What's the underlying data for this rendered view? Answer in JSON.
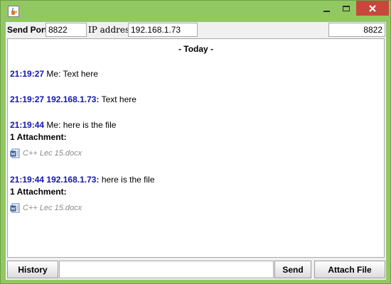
{
  "toolbar": {
    "send_port_label": "Send Port",
    "send_port_value": "8822",
    "ip_label": "IP address",
    "ip_value": "192.168.1.73",
    "listen_port_value": "8822"
  },
  "chat": {
    "day_header": "- Today -",
    "messages": [
      {
        "time": "21:19:27",
        "sender": "Me",
        "text": "Text here"
      },
      {
        "time": "21:19:27",
        "sender": "192.168.1.73",
        "text": "Text here"
      },
      {
        "time": "21:19:44",
        "sender": "Me",
        "text": "here is the file",
        "attachment_title": "1 Attachment:",
        "attachment_file": "C++ Lec 15.docx"
      },
      {
        "time": "21:19:44",
        "sender": "192.168.1.73",
        "text": "here is the file",
        "attachment_title": "1 Attachment:",
        "attachment_file": "C++ Lec 15.docx"
      }
    ]
  },
  "bottom": {
    "history_label": "History",
    "message_value": "",
    "send_label": "Send",
    "attach_label": "Attach File"
  },
  "colors": {
    "titlebar": "#92c862",
    "close_button": "#c7473d",
    "timestamp": "#1414b8"
  },
  "icons": {
    "app": "java-cup-icon",
    "attachment": "word-document-icon"
  }
}
